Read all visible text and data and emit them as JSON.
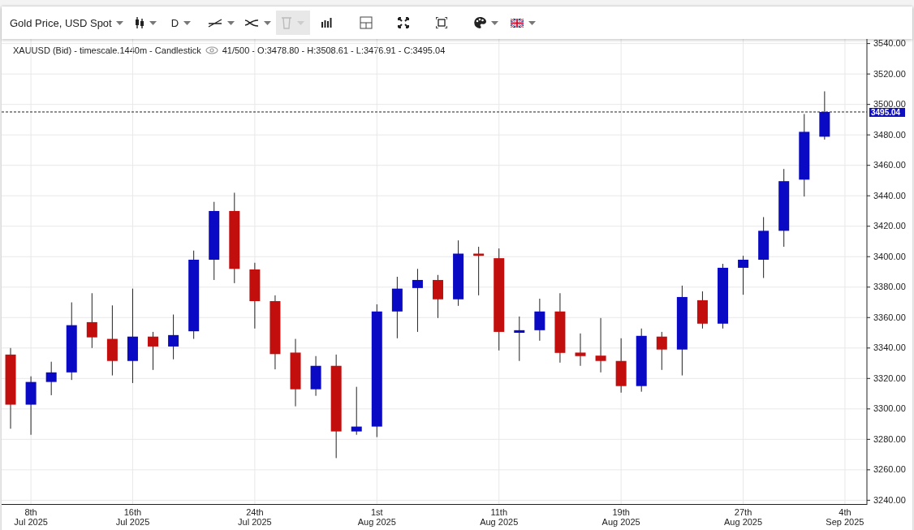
{
  "toolbar": {
    "instrument": "Gold Price, USD Spot",
    "timeframe": "D",
    "delete_disabled": true
  },
  "legend": {
    "title": "XAUUSD (Bid) - timescale.1440m - Candlestick",
    "values": "41/500 - O:3478.80 - H:3508.61 - L:3476.91 - C:3495.04"
  },
  "chart_data": {
    "type": "candlestick",
    "grid": true,
    "categories": [
      null,
      "8th\nJul 2025",
      null,
      null,
      null,
      null,
      "16th\nJul 2025",
      null,
      null,
      null,
      null,
      null,
      "24th\nJul 2025",
      null,
      null,
      null,
      null,
      null,
      "1st\nAug 2025",
      null,
      null,
      null,
      null,
      null,
      "11th\nAug 2025",
      null,
      null,
      null,
      null,
      null,
      "19th\nAug 2025",
      null,
      null,
      null,
      null,
      null,
      "27th\nAug 2025",
      null,
      null,
      null,
      null,
      "4th\nSep 2025"
    ],
    "ylim": [
      3237,
      3543
    ],
    "yticks": [
      {
        "value": 3240,
        "label": "3240.00"
      },
      {
        "value": 3260,
        "label": "3260.00"
      },
      {
        "value": 3280,
        "label": "3280.00"
      },
      {
        "value": 3300,
        "label": "3300.00"
      },
      {
        "value": 3320,
        "label": "3320.00"
      },
      {
        "value": 3340,
        "label": "3340.00"
      },
      {
        "value": 3360,
        "label": "3360.00"
      },
      {
        "value": 3380,
        "label": "3380.00"
      },
      {
        "value": 3400,
        "label": "3400.00"
      },
      {
        "value": 3420,
        "label": "3420.00"
      },
      {
        "value": 3440,
        "label": "3440.00"
      },
      {
        "value": 3460,
        "label": "3460.00"
      },
      {
        "value": 3480,
        "label": "3480.00"
      },
      {
        "value": 3500,
        "label": "3500.00"
      },
      {
        "value": 3520,
        "label": "3520.00"
      },
      {
        "value": 3540,
        "label": "3540.00"
      }
    ],
    "ref_lines": [
      {
        "axis": "y",
        "value": 3495.04,
        "label": "3495.04"
      }
    ],
    "ohlc": [
      [
        3335.7,
        3340,
        3287,
        3302.8
      ],
      [
        3302.8,
        3321.4,
        3283,
        3317.7
      ],
      [
        3317.7,
        3331,
        3309,
        3324
      ],
      [
        3324,
        3370,
        3319,
        3355
      ],
      [
        3357,
        3376,
        3340,
        3347
      ],
      [
        3346,
        3368,
        3322,
        3331.5
      ],
      [
        3331.5,
        3379,
        3317,
        3347.5
      ],
      [
        3347.5,
        3350.6,
        3325.6,
        3341
      ],
      [
        3341,
        3362,
        3332.6,
        3348.5
      ],
      [
        3351,
        3404,
        3346,
        3398
      ],
      [
        3398,
        3436,
        3384.7,
        3430
      ],
      [
        3430,
        3442,
        3382.6,
        3392
      ],
      [
        3391.6,
        3396,
        3352.8,
        3370.8
      ],
      [
        3370.8,
        3374.6,
        3326,
        3336
      ],
      [
        3337,
        3346,
        3301.7,
        3312.9
      ],
      [
        3312.9,
        3334.7,
        3308.6,
        3328.3
      ],
      [
        3328.3,
        3335.7,
        3267.7,
        3285.2
      ],
      [
        3285.2,
        3314.5,
        3283,
        3288.4
      ],
      [
        3288.4,
        3368.7,
        3281.5,
        3364
      ],
      [
        3364,
        3386.8,
        3346.4,
        3379
      ],
      [
        3379.4,
        3392,
        3350.6,
        3384.7
      ],
      [
        3384.7,
        3388,
        3359.7,
        3372
      ],
      [
        3372,
        3410.7,
        3367.7,
        3402
      ],
      [
        3402,
        3406.5,
        3374.6,
        3400.6
      ],
      [
        3399,
        3405.4,
        3338.4,
        3350.6
      ],
      [
        3350,
        3360.7,
        3331.5,
        3351.7
      ],
      [
        3351.7,
        3372.4,
        3344.8,
        3364
      ],
      [
        3364,
        3376,
        3330.4,
        3336.8
      ],
      [
        3337,
        3349.6,
        3328.3,
        3334.7
      ],
      [
        3335,
        3359.7,
        3324,
        3331.5
      ],
      [
        3331.5,
        3346.4,
        3310.7,
        3315
      ],
      [
        3315,
        3352.8,
        3311.3,
        3348
      ],
      [
        3347.5,
        3350.6,
        3325.6,
        3339
      ],
      [
        3339,
        3381,
        3322,
        3373.5
      ],
      [
        3371.4,
        3377.2,
        3352.8,
        3356
      ],
      [
        3356,
        3395.3,
        3352.8,
        3392.7
      ],
      [
        3392.7,
        3400.6,
        3375,
        3398
      ],
      [
        3398,
        3426,
        3386,
        3417
      ],
      [
        3417,
        3457.6,
        3406.5,
        3449.6
      ],
      [
        3450.6,
        3493.7,
        3439.5,
        3482
      ],
      [
        3478.8,
        3508.61,
        3476.91,
        3495.04
      ],
      null
    ]
  }
}
